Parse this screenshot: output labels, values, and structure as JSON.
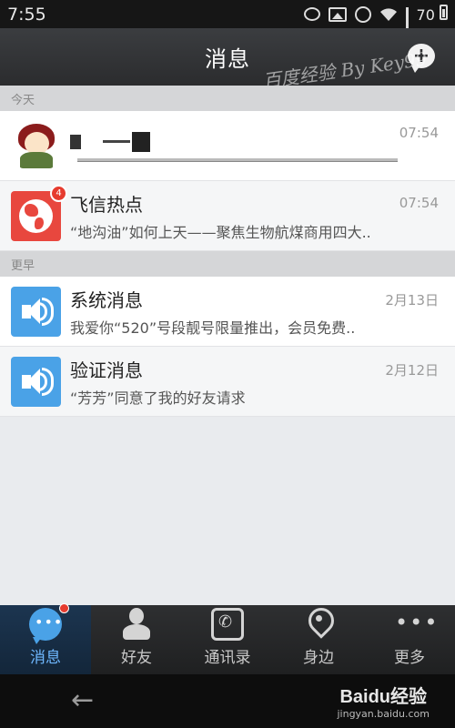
{
  "status_bar": {
    "time": "7:55",
    "battery": "70"
  },
  "header": {
    "title": "消息",
    "add_icon": "chat-plus-icon",
    "watermark": "百度经验 By Key99"
  },
  "sections": {
    "today": "今天",
    "earlier": "更早"
  },
  "conversations": [
    {
      "name": "",
      "preview": "",
      "time": "07:54",
      "avatar": "doll-avatar"
    },
    {
      "name": "飞信热点",
      "preview": "“地沟油”如何上天——聚焦生物航煤商用四大..",
      "time": "07:54",
      "avatar": "globe-icon",
      "badge": "4"
    },
    {
      "name": "系统消息",
      "preview": "我爱你“520”号段靓号限量推出，会员免费..",
      "time": "2月13日",
      "avatar": "speaker-icon"
    },
    {
      "name": "验证消息",
      "preview": "“芳芳”同意了我的好友请求",
      "time": "2月12日",
      "avatar": "speaker-icon"
    }
  ],
  "tabs": [
    {
      "label": "消息",
      "icon": "chat-bubble-icon",
      "active": true
    },
    {
      "label": "好友",
      "icon": "person-icon"
    },
    {
      "label": "通讯录",
      "icon": "phonebook-icon"
    },
    {
      "label": "身边",
      "icon": "location-pin-icon"
    },
    {
      "label": "更多",
      "icon": "more-dots-icon"
    }
  ],
  "system_nav": {
    "back_icon": "back-arrow-icon",
    "brand_logo": "Baidu经验",
    "brand_sub": "jingyan.baidu.com"
  },
  "colors": {
    "accent_blue": "#4aa2e7",
    "badge_red": "#e63b2e",
    "active_tab_text": "#6fb8ff"
  }
}
